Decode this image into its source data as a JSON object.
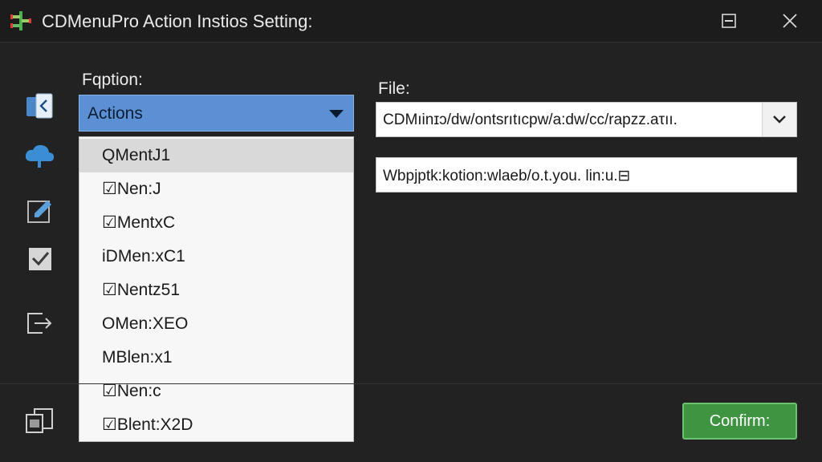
{
  "window": {
    "title": "CDMenuPro Action Instios Setting:"
  },
  "sidebar": {
    "items": [
      {
        "icon": "user-card-icon"
      },
      {
        "icon": "cloud-upload-icon"
      },
      {
        "icon": "edit-icon"
      },
      {
        "icon": "checkbox-icon"
      },
      {
        "icon": "export-icon"
      },
      {
        "icon": "copy-window-icon"
      }
    ]
  },
  "option": {
    "label": "Fqption:",
    "selected": "Actions",
    "items": [
      "QMentJ1",
      "☑Nen:J",
      "☑MentxC",
      "iDMen:xC1",
      "☑Nentz51",
      "OMen:XEO",
      "MBlen:x1",
      "☑Nen:c",
      "☑Blent:X2D"
    ]
  },
  "file": {
    "label": "File:",
    "value": "CDMıinɪɔ/dw/ontsrıtıcpw/a:dw/cc/rapzz.aτıı.",
    "path": "Wbpjptk:kotion:wlaeb/o.t.you. lin:u.⊟"
  },
  "actions": {
    "confirm_label": "Confirm:"
  },
  "colors": {
    "accent": "#5b91d4",
    "confirm": "#3f9442",
    "background": "#222222"
  }
}
